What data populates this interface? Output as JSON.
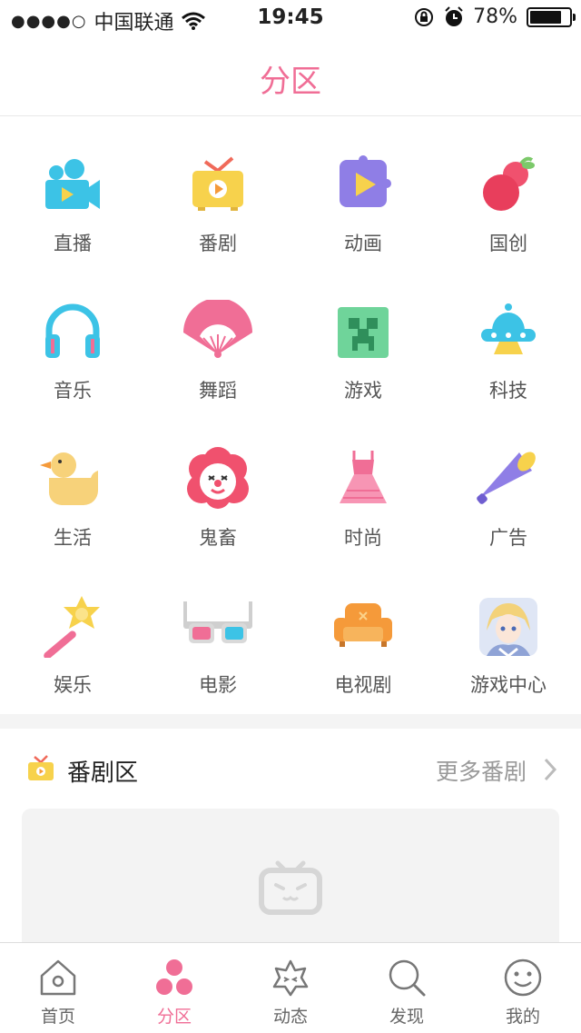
{
  "status_bar": {
    "signal_dots": "●●●●○",
    "carrier": "中国联通",
    "time": "19:45",
    "battery": "78%"
  },
  "header": {
    "title": "分区"
  },
  "categories": [
    {
      "label": "直播",
      "icon": "camera-icon"
    },
    {
      "label": "番剧",
      "icon": "tv-icon"
    },
    {
      "label": "动画",
      "icon": "puzzle-play-icon"
    },
    {
      "label": "国创",
      "icon": "gourd-icon"
    },
    {
      "label": "音乐",
      "icon": "headphones-icon"
    },
    {
      "label": "舞蹈",
      "icon": "fan-icon"
    },
    {
      "label": "游戏",
      "icon": "creeper-icon"
    },
    {
      "label": "科技",
      "icon": "ufo-icon"
    },
    {
      "label": "生活",
      "icon": "duck-icon"
    },
    {
      "label": "鬼畜",
      "icon": "clown-icon"
    },
    {
      "label": "时尚",
      "icon": "dress-icon"
    },
    {
      "label": "广告",
      "icon": "megaphone-icon"
    },
    {
      "label": "娱乐",
      "icon": "magic-wand-icon"
    },
    {
      "label": "电影",
      "icon": "3d-glasses-icon"
    },
    {
      "label": "电视剧",
      "icon": "sofa-icon"
    },
    {
      "label": "游戏中心",
      "icon": "anime-avatar-icon"
    }
  ],
  "section": {
    "title": "番剧区",
    "more": "更多番剧"
  },
  "tabs": [
    {
      "label": "首页",
      "icon": "home-icon",
      "active": false
    },
    {
      "label": "分区",
      "icon": "partition-icon",
      "active": true
    },
    {
      "label": "动态",
      "icon": "dynamic-icon",
      "active": false
    },
    {
      "label": "发现",
      "icon": "search-icon",
      "active": false
    },
    {
      "label": "我的",
      "icon": "smile-icon",
      "active": false
    }
  ],
  "colors": {
    "accent": "#f06e96",
    "text_gray": "#555555"
  }
}
